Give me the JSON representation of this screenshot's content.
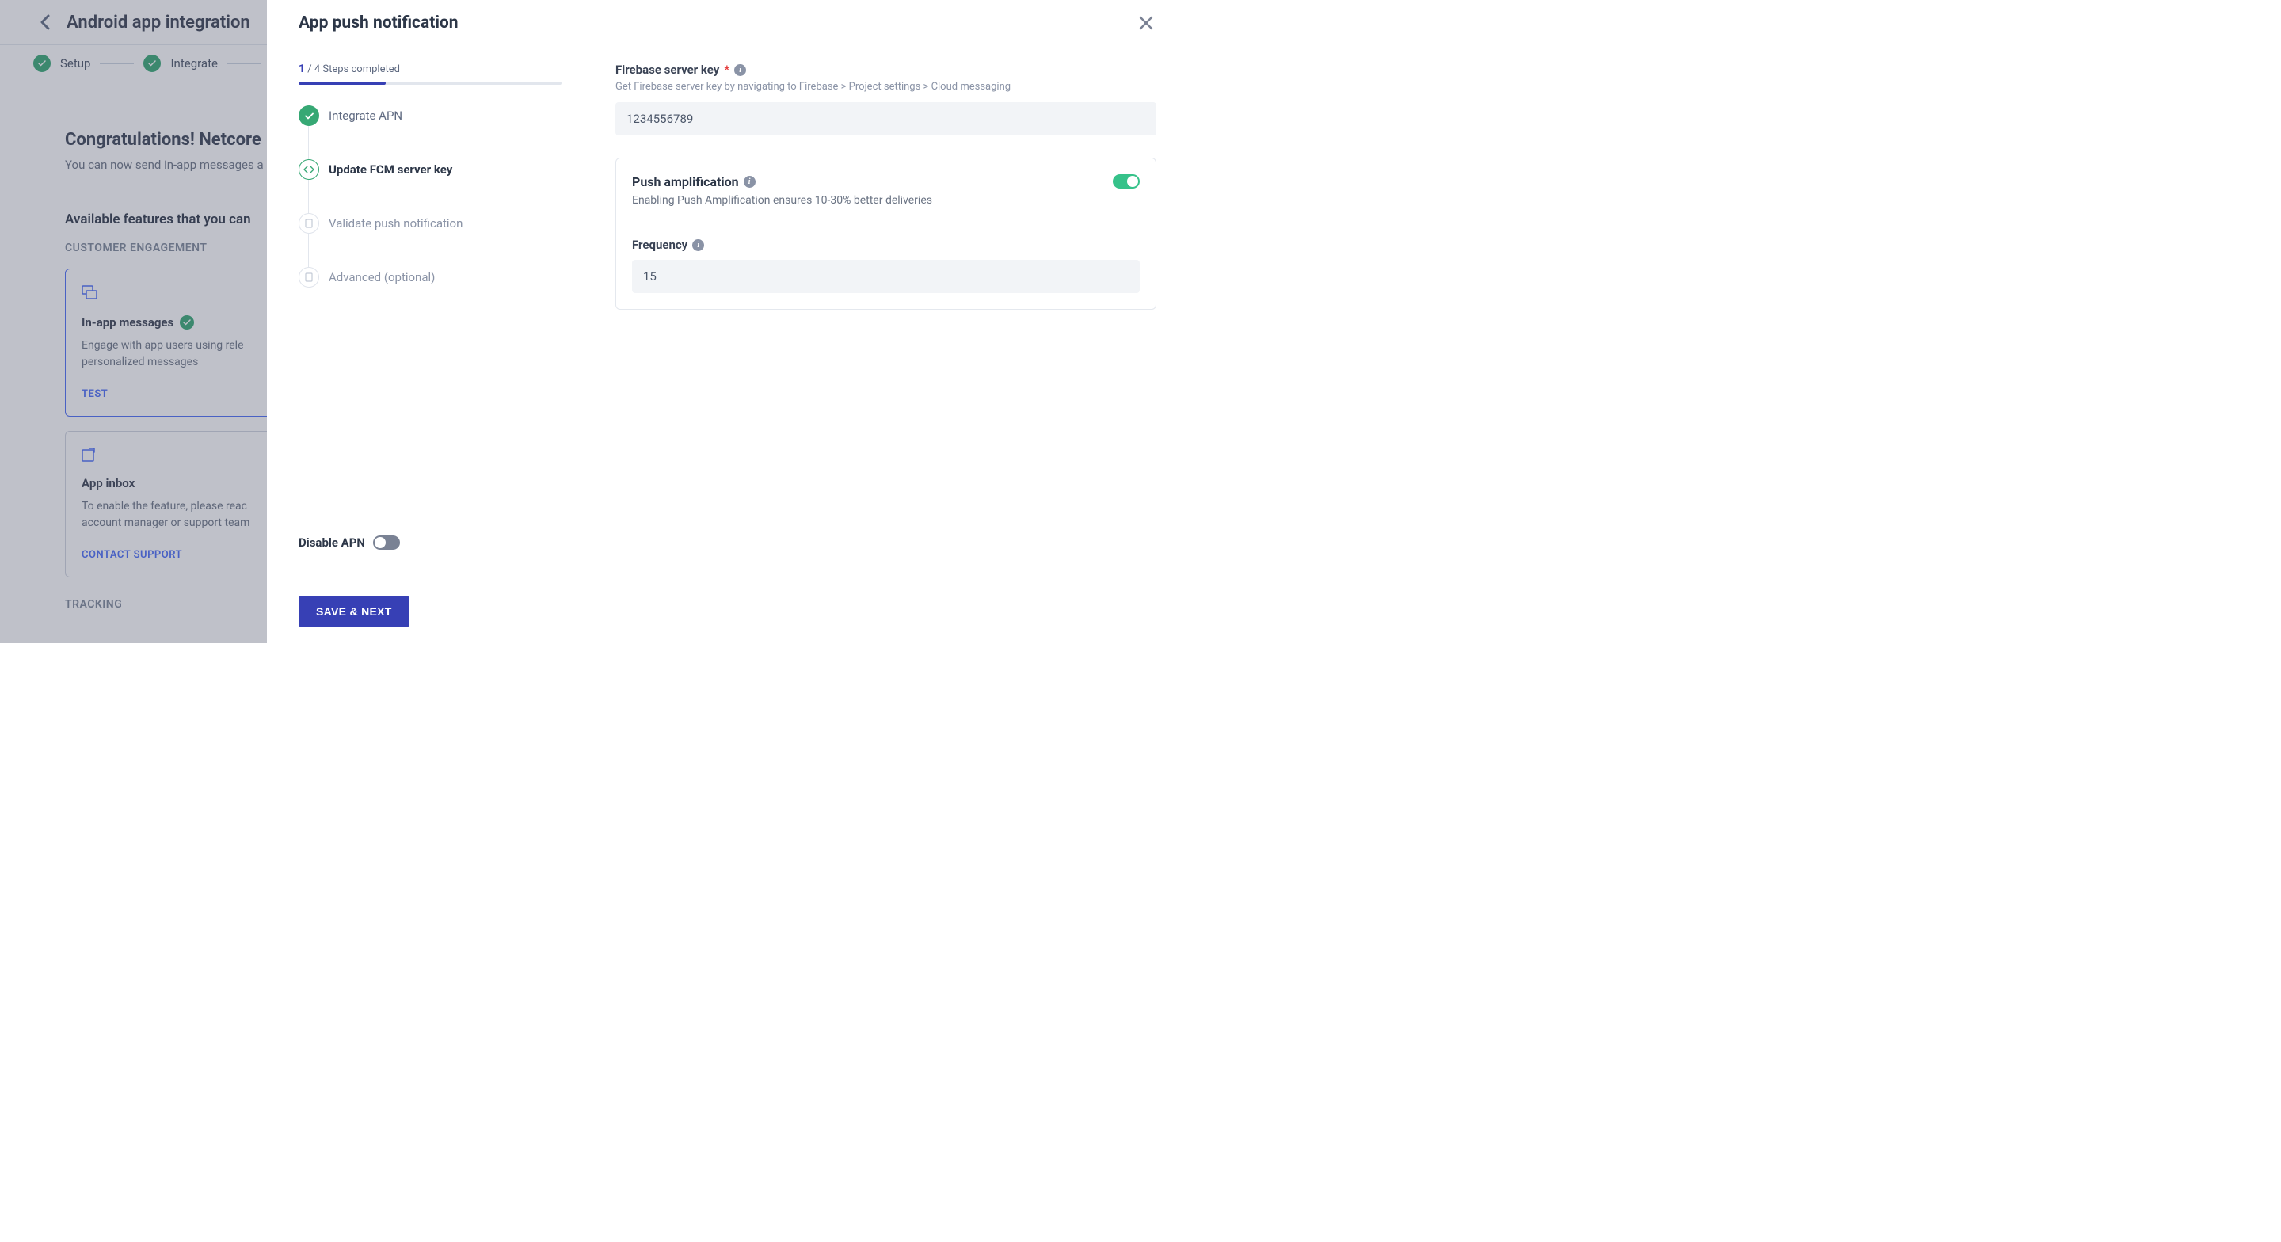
{
  "background": {
    "page_title": "Android app integration",
    "stepper": {
      "setup": "Setup",
      "integrate": "Integrate"
    },
    "congrats_title": "Congratulations! Netcore",
    "congrats_desc": "You can now send in-app messages a",
    "available_title": "Available features that you can",
    "section_engagement": "CUSTOMER ENGAGEMENT",
    "section_tracking": "TRACKING",
    "card_inapp": {
      "title": "In-app messages",
      "desc": "Engage with app users using rele personalized messages",
      "link": "TEST"
    },
    "card_inbox": {
      "title": "App inbox",
      "desc": "To enable the feature, please reac account manager or support team",
      "link": "CONTACT SUPPORT"
    }
  },
  "modal": {
    "title": "App push notification",
    "progress": {
      "completed": "1",
      "suffix": "/ 4 Steps completed",
      "fill_percent": 33
    },
    "steps": [
      {
        "label": "Integrate APN",
        "state": "done"
      },
      {
        "label": "Update FCM server key",
        "state": "current"
      },
      {
        "label": "Validate push notification",
        "state": "pending"
      },
      {
        "label": "Advanced (optional)",
        "state": "pending"
      }
    ],
    "disable_apn_label": "Disable APN",
    "save_button": "SAVE & NEXT",
    "form": {
      "firebase_label": "Firebase server key",
      "firebase_help": "Get Firebase server key by navigating to Firebase > Project settings > Cloud messaging",
      "firebase_value": "1234556789",
      "push_amp_title": "Push amplification",
      "push_amp_desc": "Enabling Push Amplification ensures 10-30% better deliveries",
      "frequency_label": "Frequency",
      "frequency_value": "15"
    }
  }
}
